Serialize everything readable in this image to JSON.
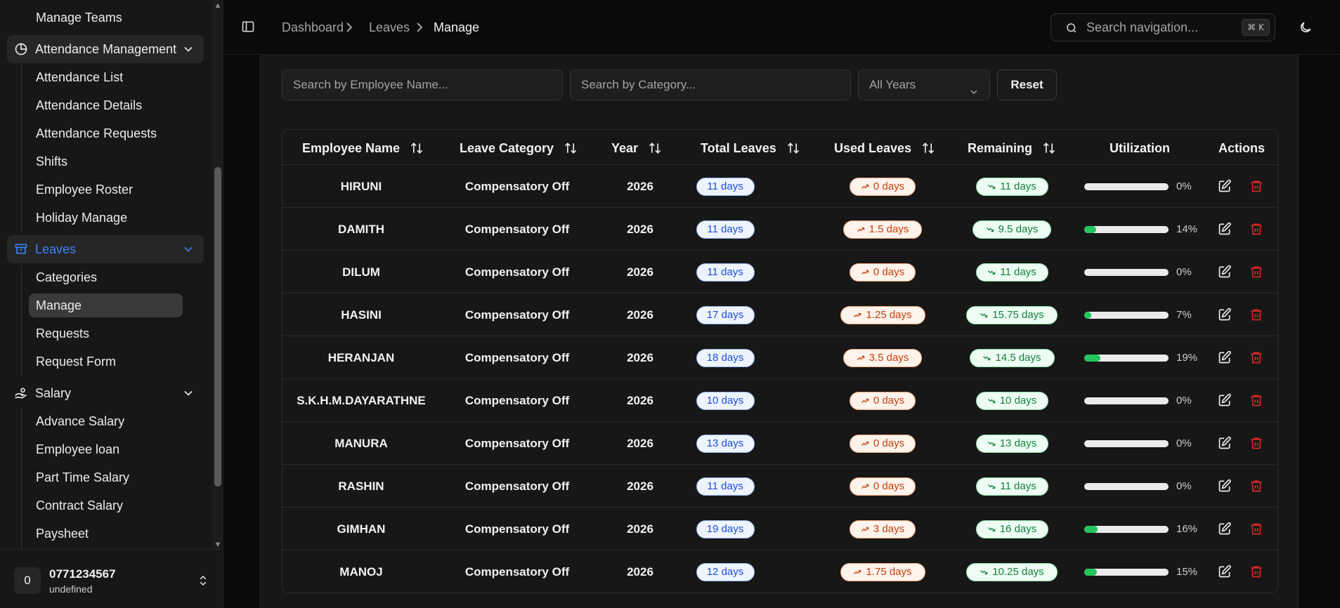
{
  "sidebar": {
    "top_item": "Manage Teams",
    "attendance_group": "Attendance Management",
    "attendance_items": [
      "Attendance List",
      "Attendance Details",
      "Attendance Requests",
      "Shifts",
      "Employee Roster",
      "Holiday Manage"
    ],
    "leaves_group": "Leaves",
    "leaves_items": [
      "Categories",
      "Manage",
      "Requests",
      "Request Form"
    ],
    "salary_group": "Salary",
    "salary_items": [
      "Advance Salary",
      "Employee loan",
      "Part Time Salary",
      "Contract Salary",
      "Paysheet"
    ],
    "accent_color": "#3b82f6"
  },
  "user": {
    "avatar_initial": "0",
    "phone": "0771234567",
    "subtitle": "undefined"
  },
  "header": {
    "breadcrumb": [
      "Dashboard",
      "Leaves",
      "Manage"
    ],
    "search_placeholder": "Search navigation...",
    "shortcut": "⌘ K"
  },
  "filters": {
    "employee_placeholder": "Search by Employee Name...",
    "category_placeholder": "Search by Category...",
    "year_selected": "All Years",
    "reset_label": "Reset"
  },
  "table": {
    "columns": [
      "Employee Name",
      "Leave Category",
      "Year",
      "Total Leaves",
      "Used Leaves",
      "Remaining",
      "Utilization",
      "Actions"
    ],
    "rows": [
      {
        "name": "HIRUNI",
        "category": "Compensatory Off",
        "year": "2026",
        "total": "11 days",
        "used": "0 days",
        "remaining": "11 days",
        "util": 0,
        "util_label": "0%"
      },
      {
        "name": "DAMITH",
        "category": "Compensatory Off",
        "year": "2026",
        "total": "11 days",
        "used": "1.5 days",
        "remaining": "9.5 days",
        "util": 14,
        "util_label": "14%"
      },
      {
        "name": "DILUM",
        "category": "Compensatory Off",
        "year": "2026",
        "total": "11 days",
        "used": "0 days",
        "remaining": "11 days",
        "util": 0,
        "util_label": "0%"
      },
      {
        "name": "HASINI",
        "category": "Compensatory Off",
        "year": "2026",
        "total": "17 days",
        "used": "1.25 days",
        "remaining": "15.75 days",
        "util": 7,
        "util_label": "7%"
      },
      {
        "name": "HERANJAN",
        "category": "Compensatory Off",
        "year": "2026",
        "total": "18 days",
        "used": "3.5 days",
        "remaining": "14.5 days",
        "util": 19,
        "util_label": "19%"
      },
      {
        "name": "S.K.H.M.DAYARATHNE",
        "category": "Compensatory Off",
        "year": "2026",
        "total": "10 days",
        "used": "0 days",
        "remaining": "10 days",
        "util": 0,
        "util_label": "0%"
      },
      {
        "name": "MANURA",
        "category": "Compensatory Off",
        "year": "2026",
        "total": "13 days",
        "used": "0 days",
        "remaining": "13 days",
        "util": 0,
        "util_label": "0%"
      },
      {
        "name": "RASHIN",
        "category": "Compensatory Off",
        "year": "2026",
        "total": "11 days",
        "used": "0 days",
        "remaining": "11 days",
        "util": 0,
        "util_label": "0%"
      },
      {
        "name": "GIMHAN",
        "category": "Compensatory Off",
        "year": "2026",
        "total": "19 days",
        "used": "3 days",
        "remaining": "16 days",
        "util": 16,
        "util_label": "16%"
      },
      {
        "name": "MANOJ",
        "category": "Compensatory Off",
        "year": "2026",
        "total": "12 days",
        "used": "1.75 days",
        "remaining": "10.25 days",
        "util": 15,
        "util_label": "15%"
      }
    ]
  }
}
